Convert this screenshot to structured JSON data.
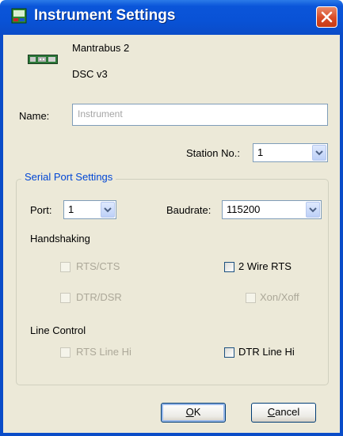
{
  "window": {
    "title": "Instrument Settings",
    "icons": {
      "app": "settings-window-icon",
      "close": "close-icon"
    }
  },
  "device": {
    "icon": "instrument-device-icon",
    "model": "Mantrabus 2",
    "version": "DSC v3"
  },
  "name_field": {
    "label": "Name:",
    "placeholder": "Instrument"
  },
  "station": {
    "label": "Station No.:",
    "value": "1"
  },
  "serial": {
    "legend": "Serial Port Settings",
    "port": {
      "label": "Port:",
      "value": "1"
    },
    "baudrate": {
      "label": "Baudrate:",
      "value": "115200"
    },
    "handshaking": {
      "label": "Handshaking",
      "rts_cts": {
        "label": "RTS/CTS",
        "checked": false,
        "enabled": false
      },
      "two_wire_rts": {
        "label": "2 Wire RTS",
        "checked": false,
        "enabled": true
      },
      "dtr_dsr": {
        "label": "DTR/DSR",
        "checked": false,
        "enabled": false
      },
      "xon_xoff": {
        "label": "Xon/Xoff",
        "checked": false,
        "enabled": false
      }
    },
    "line_control": {
      "label": "Line Control",
      "rts_line_hi": {
        "label": "RTS Line Hi",
        "checked": false,
        "enabled": false
      },
      "dtr_line_hi": {
        "label": "DTR Line Hi",
        "checked": false,
        "enabled": true
      }
    }
  },
  "buttons": {
    "ok": {
      "mnemonic": "O",
      "rest": "K"
    },
    "cancel": {
      "mnemonic": "C",
      "rest": "ancel"
    }
  },
  "colors": {
    "titlebar": "#0a55d9",
    "client_bg": "#ece9d8",
    "group_legend": "#0046d5",
    "disabled_text": "#aca899",
    "close_button": "#d84b26"
  }
}
